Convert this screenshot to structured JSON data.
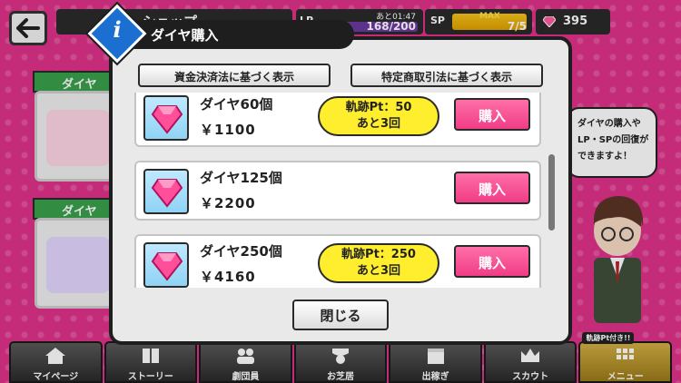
{
  "header": {
    "screen_title": "ショップ",
    "lp": {
      "label": "LP",
      "recover_time": "あと01:47",
      "value": "168/200"
    },
    "sp": {
      "label": "SP",
      "max_label": "MAX",
      "value": "7/5"
    },
    "diamonds": "395"
  },
  "background": {
    "card_tab_1": "ダイヤ",
    "card_tab_2": "ダイヤ",
    "speech_line_1": "ダイヤの購入や",
    "speech_line_2": "LP・SPの回復が",
    "speech_line_3": "できますよ！"
  },
  "dialog": {
    "title": "ダイヤ購入",
    "info_glyph": "i",
    "legal_button_1": "資金決済法に基づく表示",
    "legal_button_2": "特定商取引法に基づく表示",
    "items": [
      {
        "name": "ダイヤ60個",
        "price": "￥1100",
        "pt_line1": "軌跡Pt：50",
        "pt_line2": "あと3回",
        "buy": "購入"
      },
      {
        "name": "ダイヤ125個",
        "price": "￥2200",
        "buy": "購入"
      },
      {
        "name": "ダイヤ250個",
        "price": "￥4160",
        "pt_line1": "軌跡Pt：250",
        "pt_line2": "あと3回",
        "buy": "購入"
      }
    ],
    "close_button": "閉じる"
  },
  "bottom_nav": {
    "items": [
      {
        "label": "マイページ",
        "icon": "house-icon"
      },
      {
        "label": "ストーリー",
        "icon": "book-icon"
      },
      {
        "label": "劇団員",
        "icon": "people-icon"
      },
      {
        "label": "お芝居",
        "icon": "theater-icon"
      },
      {
        "label": "出稼ぎ",
        "icon": "box-icon"
      },
      {
        "label": "スカウト",
        "icon": "crown-icon"
      },
      {
        "label": "メニュー",
        "icon": "grid-icon"
      }
    ],
    "badge": "軌跡Pt付き!!"
  },
  "colors": {
    "background_pink": "#e0318a",
    "buy_pink": "#f03c86",
    "pt_yellow": "#ffee2e",
    "info_blue": "#1a6fd0"
  }
}
